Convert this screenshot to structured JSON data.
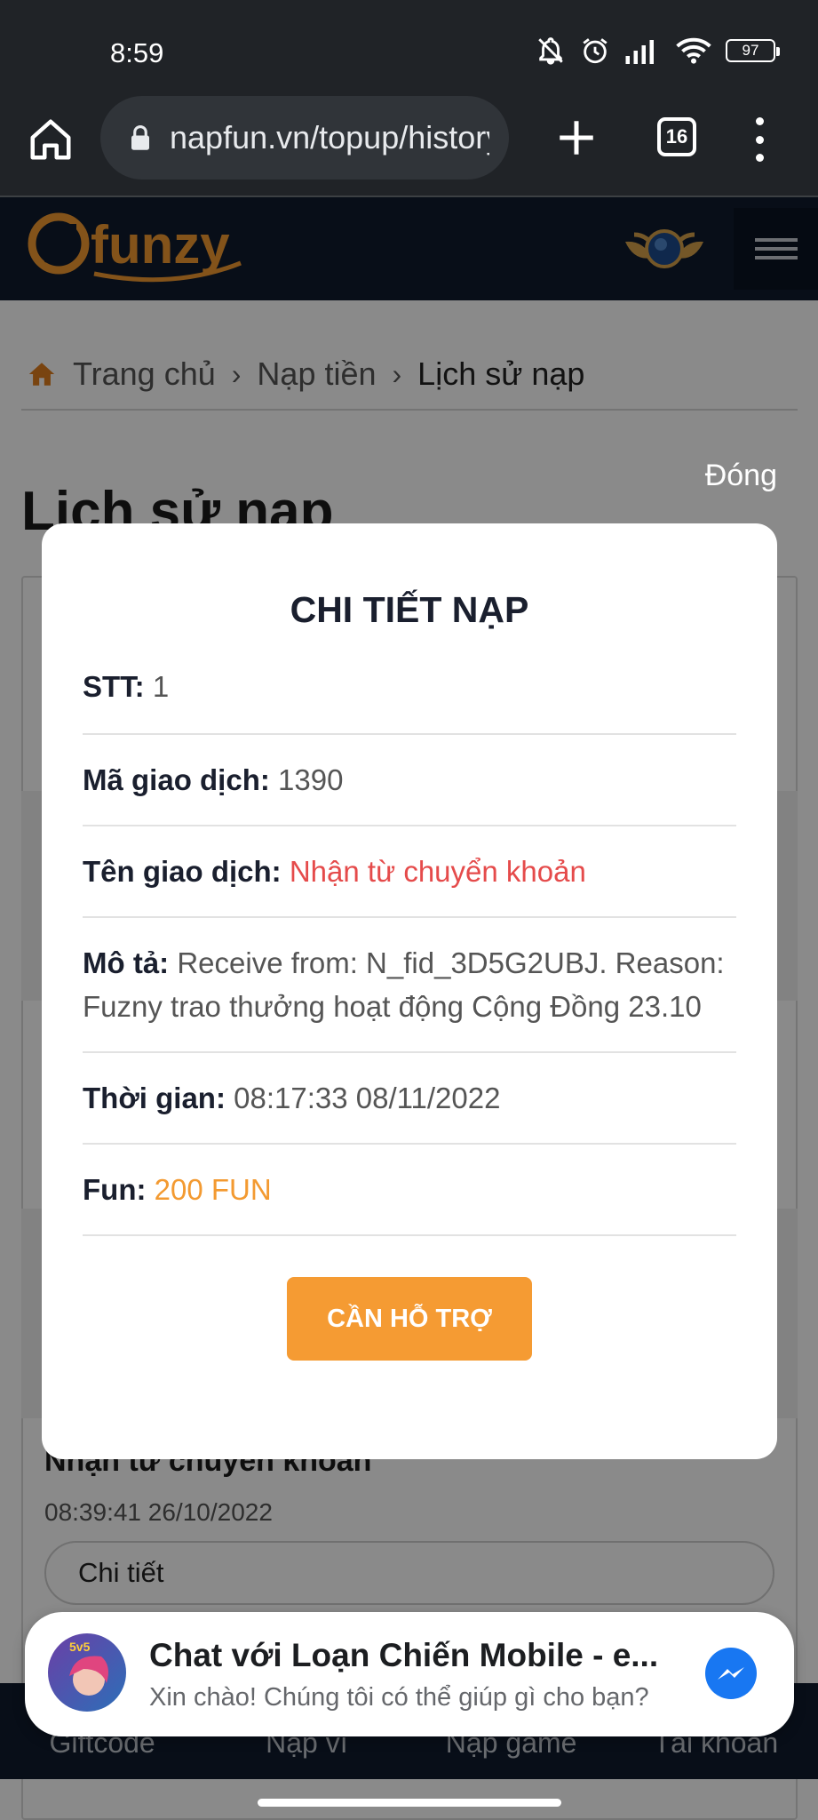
{
  "status_bar": {
    "time": "8:59",
    "battery": "97"
  },
  "browser": {
    "url": "napfun.vn/topup/history",
    "tab_count": "16"
  },
  "site": {
    "logo_text": "funzy"
  },
  "breadcrumb": {
    "home": "Trang chủ",
    "topup": "Nạp tiền",
    "current": "Lịch sử nạp"
  },
  "page": {
    "title": "Lịch sử nạp",
    "close_label": "Đóng",
    "item": {
      "title": "Nhận từ chuyển khoản",
      "time": "08:39:41 26/10/2022",
      "detail_button": "Chi tiết"
    }
  },
  "modal": {
    "title": "CHI TIẾT NẠP",
    "rows": {
      "stt_label": "STT:",
      "stt_value": "1",
      "code_label": "Mã giao dịch:",
      "code_value": "1390",
      "name_label": "Tên giao dịch:",
      "name_value": "Nhận từ chuyển khoản",
      "desc_label": "Mô tả:",
      "desc_value": "Receive from: N_fid_3D5G2UBJ. Reason: Fuzny trao thưởng hoạt động Cộng Đồng 23.10",
      "time_label": "Thời gian:",
      "time_value": "08:17:33 08/11/2022",
      "fun_label": "Fun:",
      "fun_value": "200 FUN"
    },
    "support_button": "CẦN HỖ TRỢ"
  },
  "bottom_nav": {
    "items": [
      "Giftcode",
      "Nạp ví",
      "Nạp game",
      "Tài khoản"
    ]
  },
  "chat_widget": {
    "title": "Chat với Loạn Chiến Mobile - e...",
    "subtitle": "Xin chào! Chúng tôi có thể giúp gì cho bạn?",
    "avatar_badge": "5v5"
  },
  "colors": {
    "accent_orange": "#f59b33",
    "status_red": "#e54b4b",
    "header_navy": "#0f1b2d",
    "messenger_blue": "#1877f2"
  }
}
